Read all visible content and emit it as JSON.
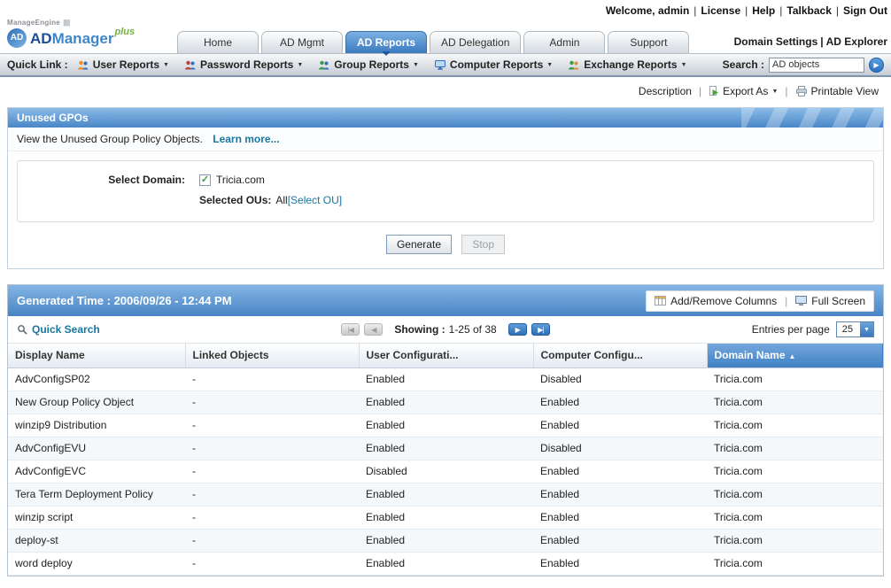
{
  "colors": {
    "titlebar_blue": "#4a86c6",
    "active_tab_blue": "#3a7ac0",
    "link_teal": "#17779e",
    "sorted_header_blue": "#4080c4",
    "logo_green": "#76b043"
  },
  "icons": {
    "go_arrow": "▶",
    "dropdown_arrow": "▼",
    "sort_ascending": "▲",
    "checkbox_check": "✓",
    "page_first": "|◀",
    "page_prev": "◀",
    "page_next": "▶",
    "page_last": "▶|"
  },
  "topbar": {
    "welcome": "Welcome, admin",
    "links": [
      "License",
      "Help",
      "Talkback",
      "Sign Out"
    ]
  },
  "brand": {
    "manageengine": "ManageEngine",
    "bars": "||||||",
    "emblem": "AD",
    "product_ad": "AD",
    "product_rest": "Manager",
    "plus": "plus"
  },
  "tabs": [
    {
      "label": "Home",
      "active": false
    },
    {
      "label": "AD Mgmt",
      "active": false
    },
    {
      "label": "AD Reports",
      "active": true
    },
    {
      "label": "AD Delegation",
      "active": false
    },
    {
      "label": "Admin",
      "active": false
    },
    {
      "label": "Support",
      "active": false
    }
  ],
  "header_right": {
    "domain_settings": "Domain Settings",
    "ad_explorer": "AD Explorer"
  },
  "quicklink": {
    "label": "Quick Link :",
    "items": [
      {
        "label": "User Reports"
      },
      {
        "label": "Password Reports"
      },
      {
        "label": "Group Reports"
      },
      {
        "label": "Computer Reports"
      },
      {
        "label": "Exchange Reports"
      }
    ],
    "search_label": "Search :",
    "search_value": "AD objects"
  },
  "toolbar": {
    "description": "Description",
    "export_as": "Export As",
    "printable_view": "Printable View"
  },
  "report": {
    "title": "Unused GPOs",
    "description": "View the Unused Group Policy Objects.",
    "learn_more": "Learn more...",
    "select_domain_label": "Select Domain:",
    "domain": "Tricia.com",
    "domain_checked": true,
    "selected_ous_label": "Selected OUs:",
    "selected_ous_value": "All",
    "select_ou_link": "[Select OU]",
    "generate_button": "Generate",
    "stop_button": "Stop"
  },
  "results": {
    "generated_time": "Generated Time : 2006/09/26 - 12:44 PM",
    "add_remove_columns": "Add/Remove Columns",
    "full_screen": "Full Screen",
    "quick_search": "Quick Search",
    "showing_label": "Showing :",
    "showing_value": "1-25 of 38",
    "entries_per_page_label": "Entries per page",
    "entries_per_page_value": "25"
  },
  "table": {
    "columns": [
      {
        "label": "Display Name",
        "sorted": false
      },
      {
        "label": "Linked Objects",
        "sorted": false
      },
      {
        "label": "User Configurati...",
        "sorted": false
      },
      {
        "label": "Computer Configu...",
        "sorted": false
      },
      {
        "label": "Domain Name",
        "sorted": true,
        "direction": "asc"
      }
    ],
    "rows": [
      [
        "AdvConfigSP02",
        "-",
        "Enabled",
        "Disabled",
        "Tricia.com"
      ],
      [
        "New Group Policy Object",
        "-",
        "Enabled",
        "Enabled",
        "Tricia.com"
      ],
      [
        "winzip9 Distribution",
        "-",
        "Enabled",
        "Enabled",
        "Tricia.com"
      ],
      [
        "AdvConfigEVU",
        "-",
        "Enabled",
        "Disabled",
        "Tricia.com"
      ],
      [
        "AdvConfigEVC",
        "-",
        "Disabled",
        "Enabled",
        "Tricia.com"
      ],
      [
        "Tera Term Deployment Policy",
        "-",
        "Enabled",
        "Enabled",
        "Tricia.com"
      ],
      [
        "winzip script",
        "-",
        "Enabled",
        "Enabled",
        "Tricia.com"
      ],
      [
        "deploy-st",
        "-",
        "Enabled",
        "Enabled",
        "Tricia.com"
      ],
      [
        "word deploy",
        "-",
        "Enabled",
        "Enabled",
        "Tricia.com"
      ]
    ]
  }
}
